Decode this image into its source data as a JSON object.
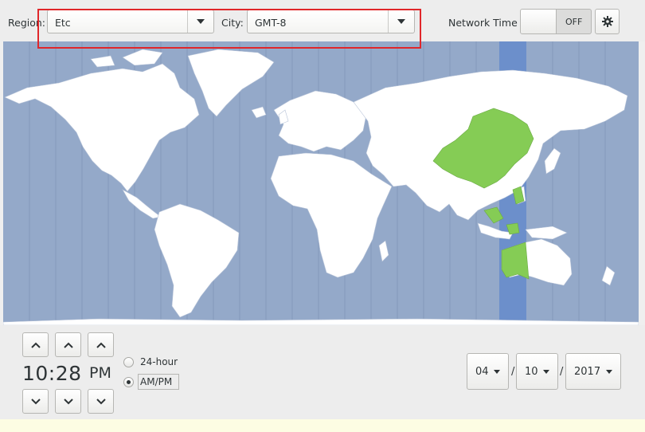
{
  "header": {
    "region_label": "Region:",
    "region_value": "Etc",
    "city_label": "City:",
    "city_value": "GMT-8",
    "network_time_label": "Network Time",
    "network_time_state": "OFF"
  },
  "clock": {
    "time": "10:28",
    "period": "PM",
    "format_options": [
      {
        "label": "24-hour",
        "selected": false
      },
      {
        "label": "AM/PM",
        "selected": true
      }
    ]
  },
  "date": {
    "month": "04",
    "day": "10",
    "year": "2017",
    "separator": "/"
  },
  "colors": {
    "ocean": "#94a9c9",
    "land": "#ffffff",
    "selected_region": "#85cc55",
    "selected_band": "#6c8fcb",
    "highlight_box": "#e0262a"
  },
  "icons": {
    "gear": "gear-icon",
    "dropdown": "triangle-down-icon",
    "up": "chevron-up-icon",
    "down": "chevron-down-icon"
  }
}
